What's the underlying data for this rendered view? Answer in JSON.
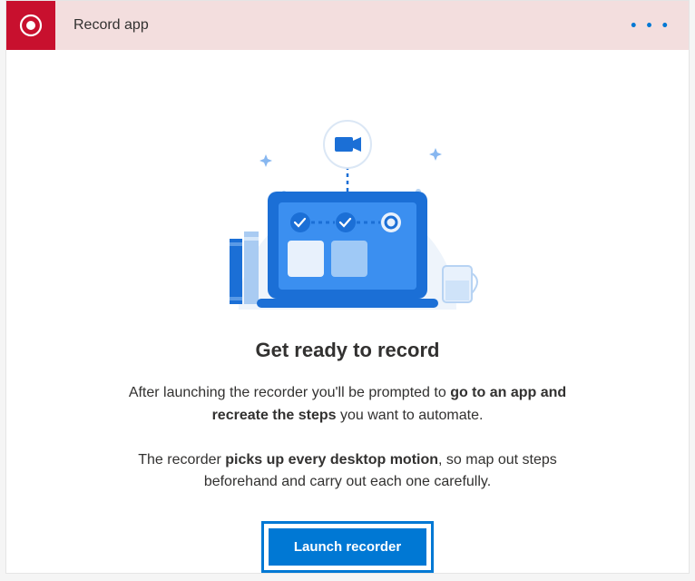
{
  "header": {
    "title": "Record app",
    "icon": "record-icon",
    "more_label": "• • •"
  },
  "main": {
    "heading": "Get ready to record",
    "para1_pre": "After launching the recorder you'll be prompted to ",
    "para1_bold": "go to an app and recreate the steps",
    "para1_post": " you want to automate.",
    "para2_pre": "The recorder ",
    "para2_bold": "picks up every desktop motion",
    "para2_post": ", so map out steps beforehand and carry out each one carefully.",
    "launch_label": "Launch recorder"
  },
  "colors": {
    "header_bg": "#f3dede",
    "accent_red": "#c8102e",
    "accent_blue": "#0078d4"
  }
}
